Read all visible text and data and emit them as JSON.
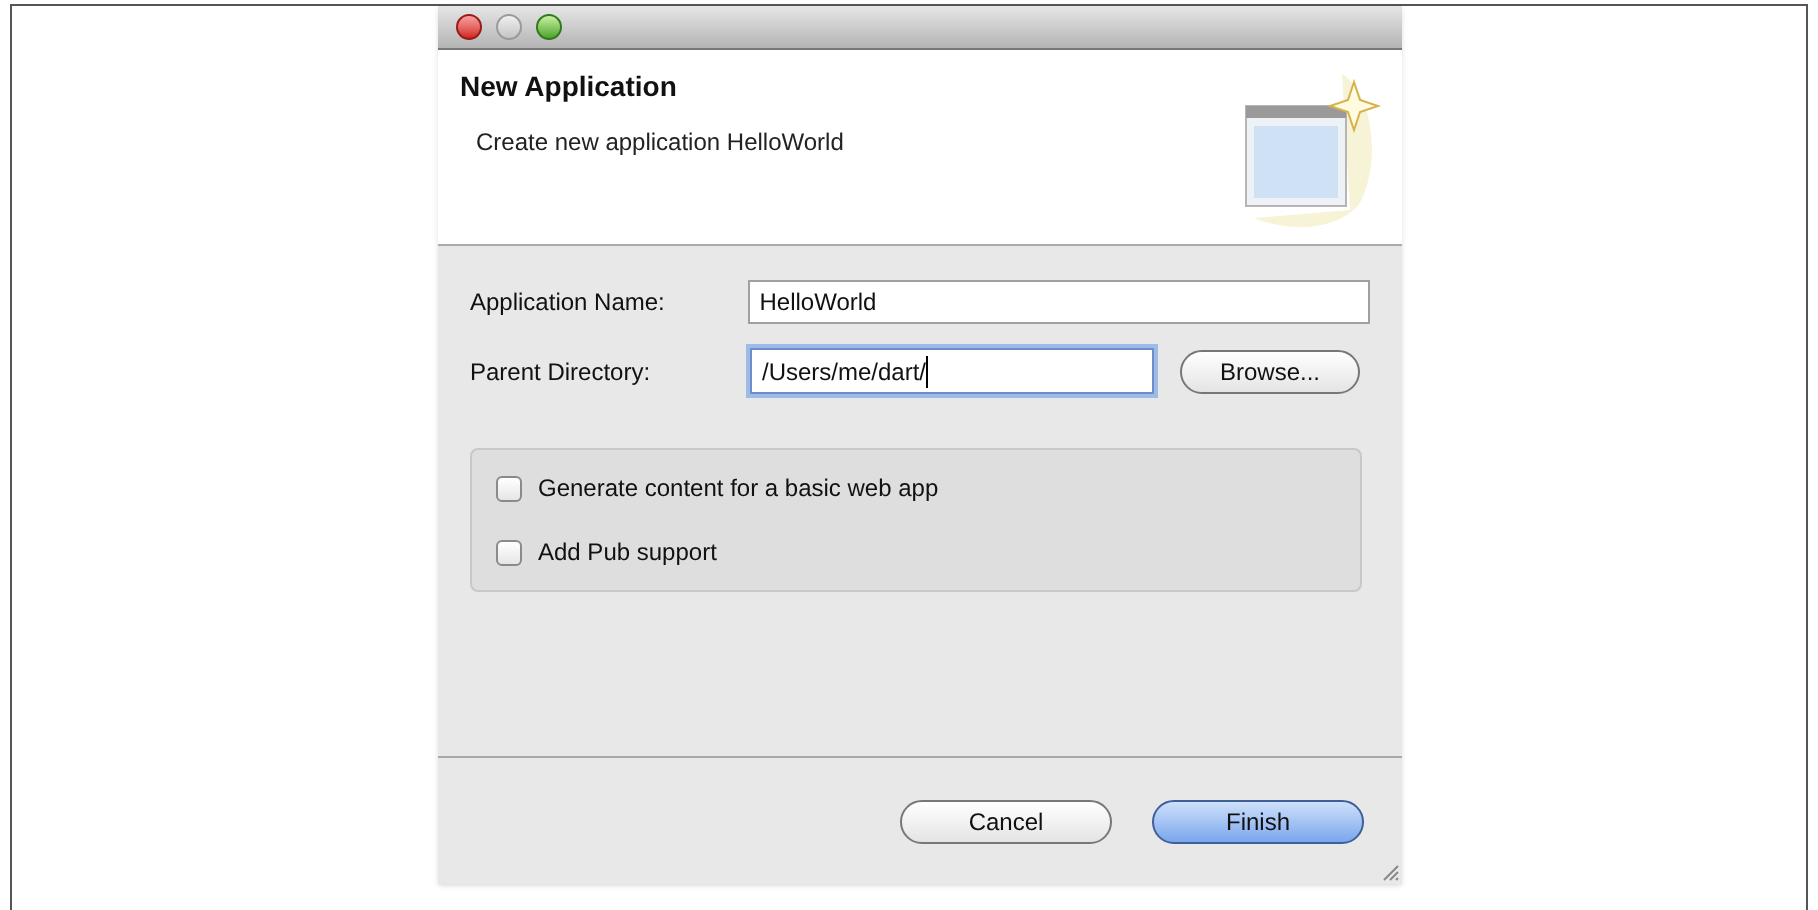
{
  "dialog": {
    "title": "New Application",
    "description": "Create new application HelloWorld"
  },
  "fields": [
    {
      "label": "Application Name:",
      "value": "HelloWorld",
      "focused": false
    },
    {
      "label": "Parent Directory:",
      "value": "/Users/me/dart/",
      "focused": true,
      "button": "Browse..."
    }
  ],
  "options": [
    {
      "label": "Generate content for a basic web app",
      "checked": false
    },
    {
      "label": "Add Pub support",
      "checked": false
    }
  ],
  "buttons": [
    {
      "label": "Cancel",
      "default": false
    },
    {
      "label": "Finish",
      "default": true
    }
  ]
}
